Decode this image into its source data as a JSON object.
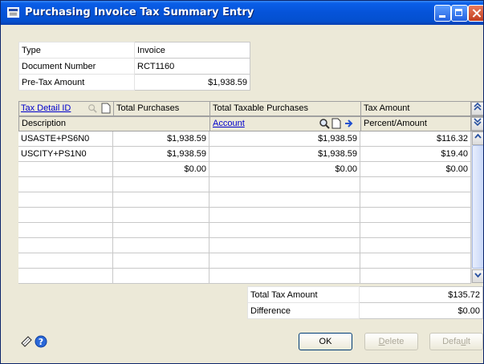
{
  "window": {
    "title": "Purchasing Invoice Tax Summary Entry"
  },
  "header_fields": [
    {
      "label": "Type",
      "value": "Invoice"
    },
    {
      "label": "Document Number",
      "value": "RCT1160"
    },
    {
      "label": "Pre-Tax Amount",
      "value": "$1,938.59"
    }
  ],
  "grid": {
    "headers_row1": {
      "tax_detail_id": "Tax Detail ID",
      "total_purchases": "Total Purchases",
      "total_taxable_purchases": "Total Taxable Purchases",
      "tax_amount": "Tax Amount"
    },
    "headers_row2": {
      "description": "Description",
      "account": "Account",
      "percent_amount": "Percent/Amount"
    },
    "rows": [
      {
        "tax_detail_id": "USASTE+PS6N0",
        "total_purchases": "$1,938.59",
        "total_taxable_purchases": "$1,938.59",
        "tax_amount": "$116.32"
      },
      {
        "tax_detail_id": "USCITY+PS1N0",
        "total_purchases": "$1,938.59",
        "total_taxable_purchases": "$1,938.59",
        "tax_amount": "$19.40"
      },
      {
        "tax_detail_id": "",
        "total_purchases": "$0.00",
        "total_taxable_purchases": "$0.00",
        "tax_amount": "$0.00"
      },
      {
        "tax_detail_id": "",
        "total_purchases": "",
        "total_taxable_purchases": "",
        "tax_amount": ""
      },
      {
        "tax_detail_id": "",
        "total_purchases": "",
        "total_taxable_purchases": "",
        "tax_amount": ""
      },
      {
        "tax_detail_id": "",
        "total_purchases": "",
        "total_taxable_purchases": "",
        "tax_amount": ""
      },
      {
        "tax_detail_id": "",
        "total_purchases": "",
        "total_taxable_purchases": "",
        "tax_amount": ""
      },
      {
        "tax_detail_id": "",
        "total_purchases": "",
        "total_taxable_purchases": "",
        "tax_amount": ""
      },
      {
        "tax_detail_id": "",
        "total_purchases": "",
        "total_taxable_purchases": "",
        "tax_amount": ""
      },
      {
        "tax_detail_id": "",
        "total_purchases": "",
        "total_taxable_purchases": "",
        "tax_amount": ""
      }
    ]
  },
  "totals": [
    {
      "label": "Total Tax Amount",
      "value": "$135.72"
    },
    {
      "label": "Difference",
      "value": "$0.00"
    }
  ],
  "buttons": {
    "ok": "OK",
    "delete_prefix": "",
    "delete_underline": "D",
    "delete_rest": "elete",
    "default_prefix": "Defa",
    "default_underline": "u",
    "default_rest": "lt"
  },
  "icons": {
    "title": "window-app-icon",
    "lookup": "lookup-magnifier-icon",
    "new": "new-document-icon",
    "expand": "expand-arrow-icon",
    "note": "note-icon",
    "help": "help-icon"
  },
  "colors": {
    "titlebar": "#0553d8",
    "link": "#0000cc",
    "window_bg": "#ece9d8"
  }
}
